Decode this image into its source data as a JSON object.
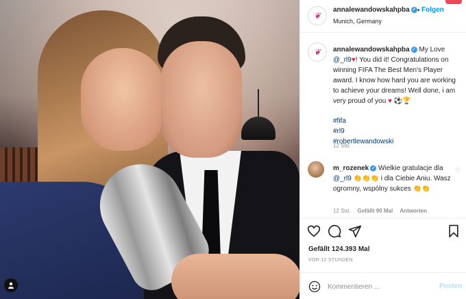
{
  "post": {
    "username": "annalewandowskahpba",
    "follow_label": "Folgen",
    "separator": "•",
    "location": "Munich, Germany"
  },
  "caption": {
    "username": "annalewandowskahpba",
    "text_1": "My Love",
    "mention": "@_rl9",
    "text_2": "! You did it! Congratulations on winning FIFA The Best Men's Player award. I know how hard you are working to achieve your dreams! Well done, i am very proud of you",
    "emoji_end": "⚽🏆",
    "hashtags": [
      "#fifa",
      "#rl9",
      "#robertlewandowski"
    ],
    "time": "12 Std."
  },
  "comment": {
    "username": "m_rozenek",
    "text_1": "Wielkie gratulacje dla",
    "mention": "@_rl9",
    "text_2": "👏👏👏 i dla Ciebie Aniu. Wasz ogromny, wspólny sukces 👏👏",
    "time": "12 Std.",
    "likes": "Gefällt 90 Mal",
    "reply_label": "Antworten"
  },
  "actions": {
    "likes_text": "Gefällt 124.393 Mal",
    "ago": "VOR 12 STUNDEN"
  },
  "comment_box": {
    "placeholder": "Kommentieren ...",
    "post_label": "Posten"
  },
  "colors": {
    "link": "#00376b",
    "accent": "#0095f6",
    "muted": "#8e8e8e",
    "verified": "#3897f0"
  }
}
